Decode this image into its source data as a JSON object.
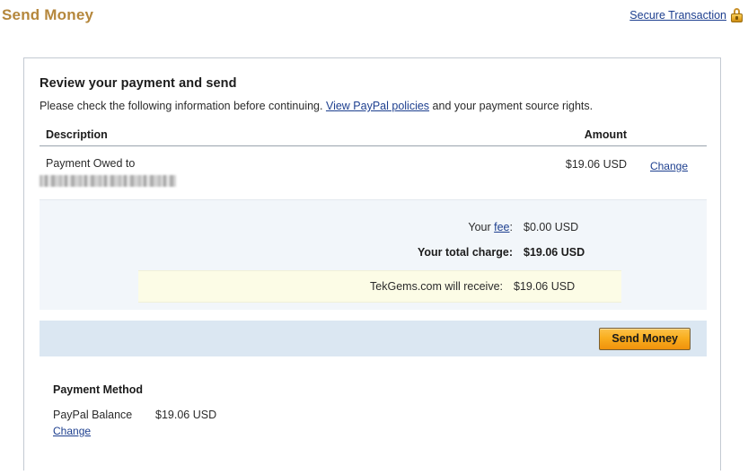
{
  "header": {
    "title": "Send Money",
    "secure_link": "Secure Transaction",
    "lock_icon": "lock-icon",
    "title_color": "#b5873c",
    "link_color": "#1d3f8f"
  },
  "main": {
    "heading": "Review your payment and send",
    "instructions_before": "Please check the following information before continuing. ",
    "policies_link": "View PayPal policies",
    "instructions_after": " and your payment source rights."
  },
  "table": {
    "columns": {
      "description": "Description",
      "amount": "Amount"
    },
    "rows": [
      {
        "description": "Payment Owed to",
        "recipient_redacted": "",
        "amount": "$19.06 USD",
        "change_label": "Change"
      }
    ]
  },
  "summary": {
    "fee_label_prefix": "Your ",
    "fee_link": "fee",
    "fee_label_suffix": ":",
    "fee_value": "$0.00 USD",
    "total_label": "Your total charge:",
    "total_value": "$19.06 USD",
    "receive_label": "TekGems.com will receive:",
    "receive_value": "$19.06 USD",
    "highlight_color": "#fcfce6",
    "panel_color": "#f2f6fa"
  },
  "action": {
    "send_button": "Send Money",
    "band_color": "#dbe7f2",
    "button_color": "#f9ae1f"
  },
  "payment_method": {
    "title": "Payment Method",
    "source": "PayPal Balance",
    "amount": "$19.06 USD",
    "change_label": "Change"
  }
}
